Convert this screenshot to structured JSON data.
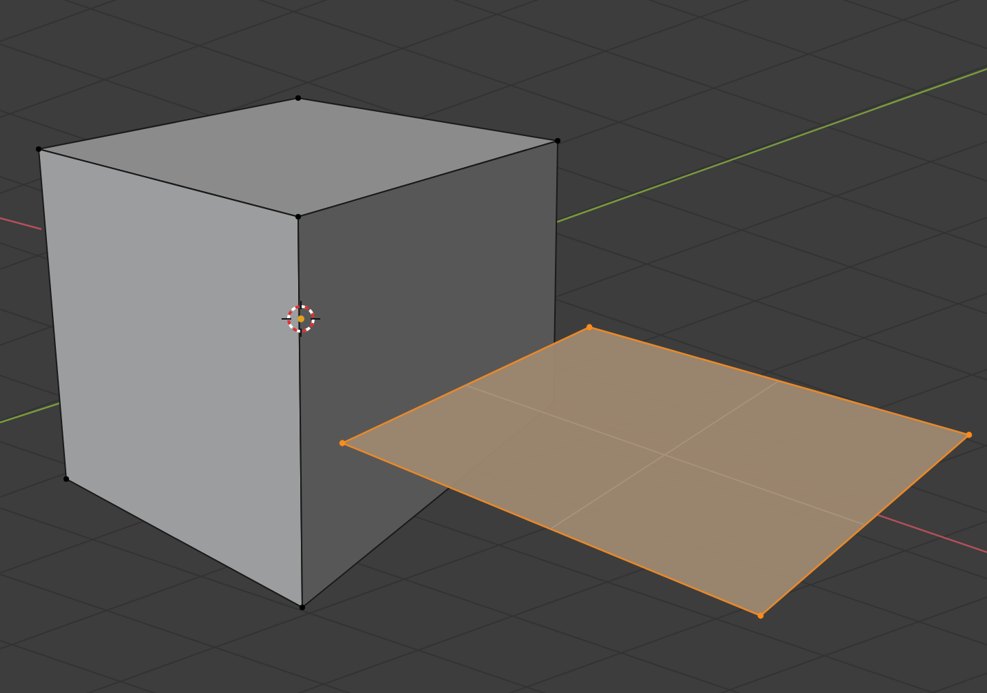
{
  "viewport": {
    "objects": [
      {
        "kind": "cube",
        "selected": false
      },
      {
        "kind": "plane",
        "selected": true
      }
    ],
    "cursor": {
      "shown": true
    }
  }
}
